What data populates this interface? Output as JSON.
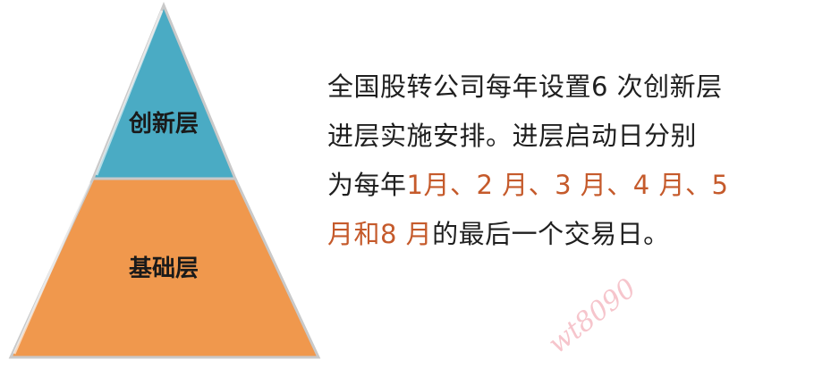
{
  "pyramid": {
    "top_tier": {
      "label": "创新层",
      "color": "#4aabc4"
    },
    "bottom_tier": {
      "label": "基础层",
      "color": "#f0984d"
    }
  },
  "description": {
    "line1": "全国股转公司每年设置6 次创新层",
    "line2": "进层实施安排。进层启动日分别",
    "line3_prefix": "为每年",
    "line3_highlight": "1月、2 月、3 月、4 月、5",
    "line4_highlight": "月和8 月",
    "line4_suffix": "的最后一个交易日。",
    "highlight_color": "#c55a2b"
  },
  "watermark": {
    "text": "wt8090"
  }
}
